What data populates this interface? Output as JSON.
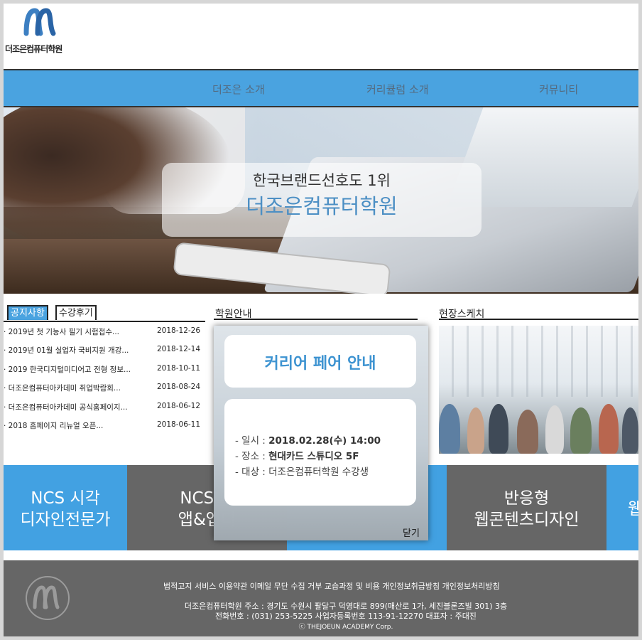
{
  "header": {
    "logo_text": "더조은컴퓨터학원"
  },
  "nav": {
    "items": [
      "더조은 소개",
      "커리큘럼 소개",
      "커뮤니티"
    ]
  },
  "hero": {
    "line1": "한국브랜드선호도 1위",
    "line2": "더조은컴퓨터학원"
  },
  "board": {
    "tabs": [
      "공지사항",
      "수강후기"
    ],
    "active_tab": "공지사항",
    "notices": [
      {
        "title": "2019년 첫 기능사 필기 시험접수...",
        "date": "2018-12-26"
      },
      {
        "title": "2019년 01월 실업자 국비지원 개강...",
        "date": "2018-12-14"
      },
      {
        "title": "2019 한국디지털미디어고 전형 정보...",
        "date": "2018-10-11"
      },
      {
        "title": "더조은컴퓨터아카데미 취업박람회...",
        "date": "2018-08-24"
      },
      {
        "title": "더조은컴퓨터아카데미 공식홈페이지...",
        "date": "2018-06-12"
      },
      {
        "title": "2018 홈페이지 리뉴얼 오픈...",
        "date": "2018-06-11"
      }
    ]
  },
  "sections": {
    "info_title": "학원안내",
    "sketch_title": "현장스케치"
  },
  "courses": [
    {
      "label": "NCS 시각\n디자인전문가",
      "color": "#42a1e2"
    },
    {
      "label": "NCS 디\n앱&앱디",
      "color": "#666666"
    },
    {
      "label": "",
      "color": "#42a1e2"
    },
    {
      "label": "반응형\n웹콘텐츠디자인",
      "color": "#666666"
    },
    {
      "label": "웹",
      "color": "#42a1e2"
    }
  ],
  "popup": {
    "title": "커리어 페어 안내",
    "lines": [
      {
        "label": "- 일시 : ",
        "value": "2018.02.28(수) 14:00"
      },
      {
        "label": "- 장소 : ",
        "value": "현대카드 스튜디오 5F"
      },
      {
        "label": "- 대상 : ",
        "value": "더조은컴퓨터학원 수강생"
      }
    ],
    "close_label": "닫기"
  },
  "footer": {
    "links": "법적고지 서비스 이용약관 이메일 무단 수집 거부 교습과정 및 비용 개인정보취급방침 개인정보처리방침",
    "address1": "더조은컴퓨터학원 주소 : 경기도 수원시 팔달구 덕영대로 899(매산로 1가, 세진블론즈빌 301) 3층",
    "address2": "전화번호 : (031) 253-5225 사업자등록번호 113-91-12270 대표자 : 주대진",
    "copyright": "ⓒ THEJOEUN ACADEMY Corp."
  }
}
